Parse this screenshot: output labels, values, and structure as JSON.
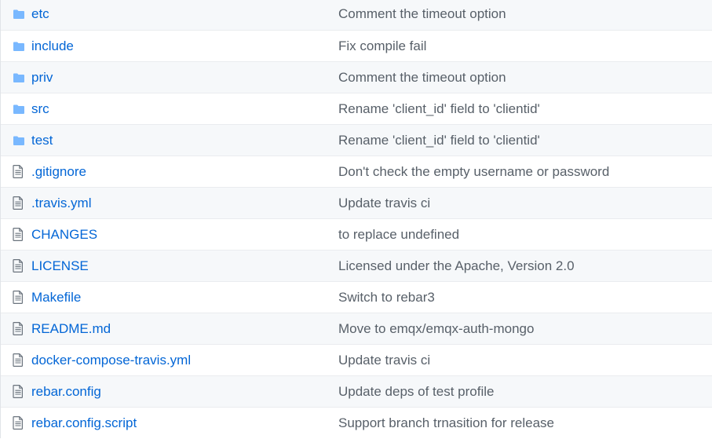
{
  "colors": {
    "link": "#0366d6",
    "message": "#586069",
    "folder_icon": "#79b8ff",
    "file_icon": "#6a737d",
    "border": "#eaecef"
  },
  "files": [
    {
      "name": "etc",
      "icon": "folder-icon",
      "message": "Comment the timeout option"
    },
    {
      "name": "include",
      "icon": "folder-icon",
      "message": "Fix compile fail"
    },
    {
      "name": "priv",
      "icon": "folder-icon",
      "message": "Comment the timeout option"
    },
    {
      "name": "src",
      "icon": "folder-icon",
      "message": "Rename 'client_id' field to 'clientid'"
    },
    {
      "name": "test",
      "icon": "folder-icon",
      "message": "Rename 'client_id' field to 'clientid'"
    },
    {
      "name": ".gitignore",
      "icon": "file-icon",
      "message": "Don't check the empty username or password"
    },
    {
      "name": ".travis.yml",
      "icon": "file-icon",
      "message": "Update travis ci"
    },
    {
      "name": "CHANGES",
      "icon": "file-icon",
      "message": "to replace undefined"
    },
    {
      "name": "LICENSE",
      "icon": "file-icon",
      "message": "Licensed under the Apache, Version 2.0"
    },
    {
      "name": "Makefile",
      "icon": "file-icon",
      "message": "Switch to rebar3"
    },
    {
      "name": "README.md",
      "icon": "file-icon",
      "message": "Move to emqx/emqx-auth-mongo"
    },
    {
      "name": "docker-compose-travis.yml",
      "icon": "file-icon",
      "message": "Update travis ci"
    },
    {
      "name": "rebar.config",
      "icon": "file-icon",
      "message": "Update deps of test profile"
    },
    {
      "name": "rebar.config.script",
      "icon": "file-icon",
      "message": "Support branch trnasition for release"
    }
  ]
}
